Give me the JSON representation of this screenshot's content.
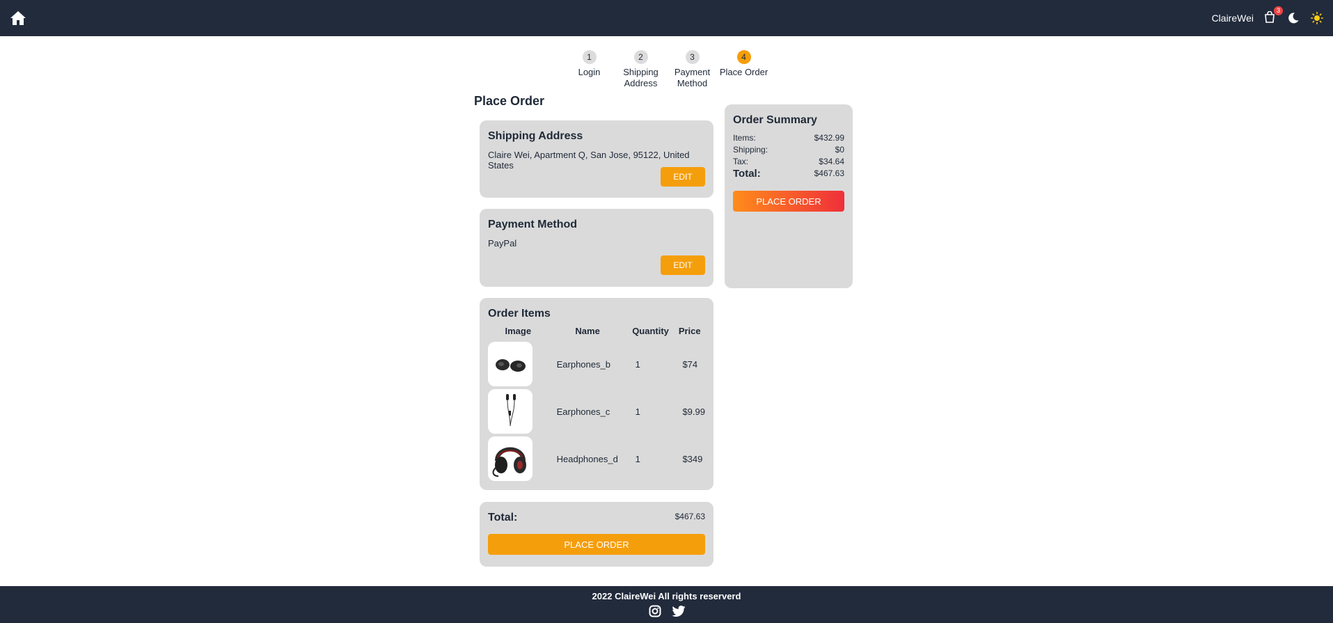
{
  "header": {
    "home_icon": "home-icon",
    "username": "ClaireWei",
    "cart_count": "3",
    "cart_icon": "shopping-bag-icon",
    "dark_mode_icon": "moon-icon",
    "light_mode_icon": "sun-icon",
    "background": "#222b3c"
  },
  "stepper": {
    "steps": [
      {
        "number": "1",
        "label": "Login"
      },
      {
        "number": "2",
        "label": "Shipping Address"
      },
      {
        "number": "3",
        "label": "Payment Method"
      },
      {
        "number": "4",
        "label": "Place Order"
      }
    ],
    "active_step": 4,
    "active_color": "#f59e0b"
  },
  "main": {
    "title": "Place Order",
    "shipping": {
      "title": "Shipping Address",
      "address": "Claire Wei, Apartment Q, San Jose, 95122, United States",
      "edit_label": "EDIT"
    },
    "payment": {
      "title": "Payment Method",
      "method": "PayPal",
      "edit_label": "EDIT"
    },
    "order_items": {
      "title": "Order Items",
      "columns": [
        "Image",
        "Name",
        "Quantity",
        "Price"
      ],
      "rows": [
        {
          "name": "Earphones_b",
          "quantity": "1",
          "price": "$74"
        },
        {
          "name": "Earphones_c",
          "quantity": "1",
          "price": "$9.99"
        },
        {
          "name": "Headphones_d",
          "quantity": "1",
          "price": "$349"
        }
      ]
    },
    "total_card": {
      "label": "Total:",
      "value": "$467.63",
      "button_label": "PLACE ORDER"
    }
  },
  "summary": {
    "title": "Order Summary",
    "items_label": "Items:",
    "items_value": "$432.99",
    "shipping_label": "Shipping:",
    "shipping_value": "$0",
    "tax_label": "Tax:",
    "tax_value": "$34.64",
    "total_label": "Total:",
    "total_value": "$467.63",
    "button_label": "PLACE ORDER"
  },
  "footer": {
    "text": "2022 ClaireWei All rights reserverd",
    "social_icons": [
      "instagram-icon",
      "twitter-icon"
    ]
  },
  "colors": {
    "accent": "#f59e0b",
    "card_bg": "#dadada",
    "gradient_start": "#ff8c1a",
    "gradient_end": "#ef2f3a"
  }
}
